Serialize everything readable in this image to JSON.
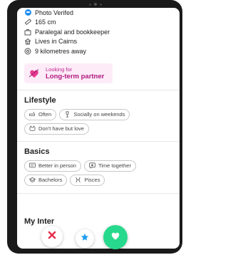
{
  "profile": {
    "details": [
      {
        "icon": "verified-badge-icon",
        "text": "Photo Verifed"
      },
      {
        "icon": "ruler-icon",
        "text": "165 cm"
      },
      {
        "icon": "briefcase-icon",
        "text": "Paralegal and bookkeeper"
      },
      {
        "icon": "home-icon",
        "text": "Lives in Cairns"
      },
      {
        "icon": "location-pin-icon",
        "text": "9 kilometres away"
      }
    ],
    "looking_for": {
      "label": "Looking for",
      "value": "Long-term partner"
    }
  },
  "lifestyle": {
    "title": "Lifestyle",
    "chips": [
      {
        "icon": "smoking-icon",
        "text": "Often"
      },
      {
        "icon": "drink-icon",
        "text": "Socially on weekends"
      },
      {
        "icon": "pet-icon",
        "text": "Don't have but love"
      }
    ]
  },
  "basics": {
    "title": "Basics",
    "chips": [
      {
        "icon": "communication-icon",
        "text": "Better in person"
      },
      {
        "icon": "love-language-icon",
        "text": "Time together"
      },
      {
        "icon": "graduation-cap-icon",
        "text": "Bachelors"
      },
      {
        "icon": "zodiac-icon",
        "text": "Pisces"
      }
    ]
  },
  "interests": {
    "title": "My Inter"
  },
  "actions": {
    "nope": "close-icon",
    "super_like": "star-icon",
    "like": "heart-icon"
  },
  "colors": {
    "accent_pink": "#c1268d",
    "like_green": "#27d98c",
    "nope_red": "#e8304f",
    "star_blue": "#1f9cf0",
    "verified_blue": "#1f8ff2"
  }
}
